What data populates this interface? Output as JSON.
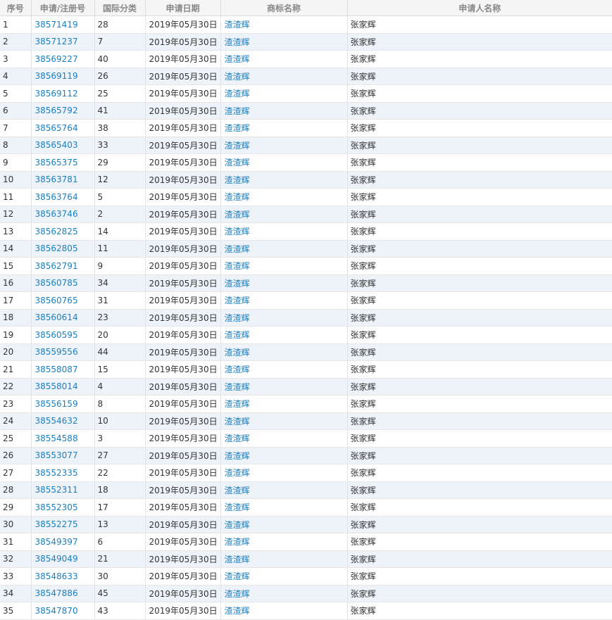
{
  "table": {
    "headers": [
      "序号",
      "申请/注册号",
      "国际分类",
      "申请日期",
      "商标名称",
      "申请人名称"
    ],
    "colors": {
      "link": "#1a7fc1",
      "header_bg": "#f5f5f5",
      "stripe": "#eef3f9"
    },
    "rows": [
      {
        "idx": "1",
        "reg": "38571419",
        "cls": "28",
        "date": "2019年05月30日",
        "mark": "渣渣辉",
        "applicant": "张家辉"
      },
      {
        "idx": "2",
        "reg": "38571237",
        "cls": "7",
        "date": "2019年05月30日",
        "mark": "渣渣辉",
        "applicant": "张家辉"
      },
      {
        "idx": "3",
        "reg": "38569227",
        "cls": "40",
        "date": "2019年05月30日",
        "mark": "渣渣辉",
        "applicant": "张家辉"
      },
      {
        "idx": "4",
        "reg": "38569119",
        "cls": "26",
        "date": "2019年05月30日",
        "mark": "渣渣辉",
        "applicant": "张家辉"
      },
      {
        "idx": "5",
        "reg": "38569112",
        "cls": "25",
        "date": "2019年05月30日",
        "mark": "渣渣辉",
        "applicant": "张家辉"
      },
      {
        "idx": "6",
        "reg": "38565792",
        "cls": "41",
        "date": "2019年05月30日",
        "mark": "渣渣辉",
        "applicant": "张家辉"
      },
      {
        "idx": "7",
        "reg": "38565764",
        "cls": "38",
        "date": "2019年05月30日",
        "mark": "渣渣辉",
        "applicant": "张家辉"
      },
      {
        "idx": "8",
        "reg": "38565403",
        "cls": "33",
        "date": "2019年05月30日",
        "mark": "渣渣辉",
        "applicant": "张家辉"
      },
      {
        "idx": "9",
        "reg": "38565375",
        "cls": "29",
        "date": "2019年05月30日",
        "mark": "渣渣辉",
        "applicant": "张家辉"
      },
      {
        "idx": "10",
        "reg": "38563781",
        "cls": "12",
        "date": "2019年05月30日",
        "mark": "渣渣辉",
        "applicant": "张家辉"
      },
      {
        "idx": "11",
        "reg": "38563764",
        "cls": "5",
        "date": "2019年05月30日",
        "mark": "渣渣辉",
        "applicant": "张家辉"
      },
      {
        "idx": "12",
        "reg": "38563746",
        "cls": "2",
        "date": "2019年05月30日",
        "mark": "渣渣辉",
        "applicant": "张家辉"
      },
      {
        "idx": "13",
        "reg": "38562825",
        "cls": "14",
        "date": "2019年05月30日",
        "mark": "渣渣辉",
        "applicant": "张家辉"
      },
      {
        "idx": "14",
        "reg": "38562805",
        "cls": "11",
        "date": "2019年05月30日",
        "mark": "渣渣辉",
        "applicant": "张家辉"
      },
      {
        "idx": "15",
        "reg": "38562791",
        "cls": "9",
        "date": "2019年05月30日",
        "mark": "渣渣辉",
        "applicant": "张家辉"
      },
      {
        "idx": "16",
        "reg": "38560785",
        "cls": "34",
        "date": "2019年05月30日",
        "mark": "渣渣辉",
        "applicant": "张家辉"
      },
      {
        "idx": "17",
        "reg": "38560765",
        "cls": "31",
        "date": "2019年05月30日",
        "mark": "渣渣辉",
        "applicant": "张家辉"
      },
      {
        "idx": "18",
        "reg": "38560614",
        "cls": "23",
        "date": "2019年05月30日",
        "mark": "渣渣辉",
        "applicant": "张家辉"
      },
      {
        "idx": "19",
        "reg": "38560595",
        "cls": "20",
        "date": "2019年05月30日",
        "mark": "渣渣辉",
        "applicant": "张家辉"
      },
      {
        "idx": "20",
        "reg": "38559556",
        "cls": "44",
        "date": "2019年05月30日",
        "mark": "渣渣辉",
        "applicant": "张家辉"
      },
      {
        "idx": "21",
        "reg": "38558087",
        "cls": "15",
        "date": "2019年05月30日",
        "mark": "渣渣辉",
        "applicant": "张家辉"
      },
      {
        "idx": "22",
        "reg": "38558014",
        "cls": "4",
        "date": "2019年05月30日",
        "mark": "渣渣辉",
        "applicant": "张家辉"
      },
      {
        "idx": "23",
        "reg": "38556159",
        "cls": "8",
        "date": "2019年05月30日",
        "mark": "渣渣辉",
        "applicant": "张家辉"
      },
      {
        "idx": "24",
        "reg": "38554632",
        "cls": "10",
        "date": "2019年05月30日",
        "mark": "渣渣辉",
        "applicant": "张家辉"
      },
      {
        "idx": "25",
        "reg": "38554588",
        "cls": "3",
        "date": "2019年05月30日",
        "mark": "渣渣辉",
        "applicant": "张家辉"
      },
      {
        "idx": "26",
        "reg": "38553077",
        "cls": "27",
        "date": "2019年05月30日",
        "mark": "渣渣辉",
        "applicant": "张家辉"
      },
      {
        "idx": "27",
        "reg": "38552335",
        "cls": "22",
        "date": "2019年05月30日",
        "mark": "渣渣辉",
        "applicant": "张家辉"
      },
      {
        "idx": "28",
        "reg": "38552311",
        "cls": "18",
        "date": "2019年05月30日",
        "mark": "渣渣辉",
        "applicant": "张家辉"
      },
      {
        "idx": "29",
        "reg": "38552305",
        "cls": "17",
        "date": "2019年05月30日",
        "mark": "渣渣辉",
        "applicant": "张家辉"
      },
      {
        "idx": "30",
        "reg": "38552275",
        "cls": "13",
        "date": "2019年05月30日",
        "mark": "渣渣辉",
        "applicant": "张家辉"
      },
      {
        "idx": "31",
        "reg": "38549397",
        "cls": "6",
        "date": "2019年05月30日",
        "mark": "渣渣辉",
        "applicant": "张家辉"
      },
      {
        "idx": "32",
        "reg": "38549049",
        "cls": "21",
        "date": "2019年05月30日",
        "mark": "渣渣辉",
        "applicant": "张家辉"
      },
      {
        "idx": "33",
        "reg": "38548633",
        "cls": "30",
        "date": "2019年05月30日",
        "mark": "渣渣辉",
        "applicant": "张家辉"
      },
      {
        "idx": "34",
        "reg": "38547886",
        "cls": "45",
        "date": "2019年05月30日",
        "mark": "渣渣辉",
        "applicant": "张家辉"
      },
      {
        "idx": "35",
        "reg": "38547870",
        "cls": "43",
        "date": "2019年05月30日",
        "mark": "渣渣辉",
        "applicant": "张家辉"
      }
    ]
  }
}
